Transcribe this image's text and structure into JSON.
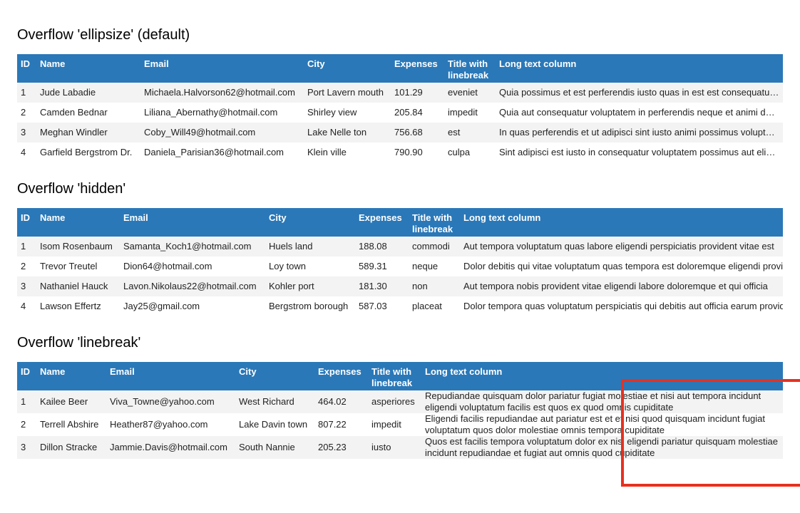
{
  "headers": {
    "id": "ID",
    "name": "Name",
    "email": "Email",
    "city": "City",
    "expenses": "Expenses",
    "title": "Title with linebreak",
    "long": "Long text column"
  },
  "sections": [
    {
      "title": "Overflow 'ellipsize' (default)",
      "rows": [
        {
          "id": "1",
          "name": "Jude Labadie",
          "email": "Michaela.Halvorson62@hotmail.com",
          "city": "Port Lavern mouth",
          "expenses": "101.29",
          "title": "eveniet",
          "long": "Quia possimus et est perferendis iusto quas in est est consequatur voluptatem dolor"
        },
        {
          "id": "2",
          "name": "Camden Bednar",
          "email": "Liliana_Abernathy@hotmail.com",
          "city": "Shirley view",
          "expenses": "205.84",
          "title": "impedit",
          "long": "Quia aut consequatur voluptatem in perferendis neque et animi dolor quisquam"
        },
        {
          "id": "3",
          "name": "Meghan Windler",
          "email": "Coby_Will49@hotmail.com",
          "city": "Lake Nelle ton",
          "expenses": "756.68",
          "title": "est",
          "long": "In quas perferendis et ut adipisci sint iusto animi possimus voluptatem laborum"
        },
        {
          "id": "4",
          "name": "Garfield Bergstrom Dr.",
          "email": "Daniela_Parisian36@hotmail.com",
          "city": "Klein ville",
          "expenses": "790.90",
          "title": "culpa",
          "long": "Sint adipisci est iusto in consequatur voluptatem possimus aut eligendi officia"
        }
      ]
    },
    {
      "title": "Overflow 'hidden'",
      "rows": [
        {
          "id": "1",
          "name": "Isom Rosenbaum",
          "email": "Samanta_Koch1@hotmail.com",
          "city": "Huels land",
          "expenses": "188.08",
          "title": "commodi",
          "long": "Aut tempora voluptatum quas labore eligendi perspiciatis provident vitae est"
        },
        {
          "id": "2",
          "name": "Trevor Treutel",
          "email": "Dion64@hotmail.com",
          "city": "Loy town",
          "expenses": "589.31",
          "title": "neque",
          "long": "Dolor debitis qui vitae voluptatum quas tempora est doloremque eligendi provident"
        },
        {
          "id": "3",
          "name": "Nathaniel Hauck",
          "email": "Lavon.Nikolaus22@hotmail.com",
          "city": "Kohler port",
          "expenses": "181.30",
          "title": "non",
          "long": "Aut tempora nobis provident vitae eligendi labore doloremque et qui officia"
        },
        {
          "id": "4",
          "name": "Lawson Effertz",
          "email": "Jay25@gmail.com",
          "city": "Bergstrom borough",
          "expenses": "587.03",
          "title": "placeat",
          "long": "Dolor tempora quas voluptatum perspiciatis qui debitis aut officia earum provident"
        }
      ]
    },
    {
      "title": "Overflow 'linebreak'",
      "rows": [
        {
          "id": "1",
          "name": "Kailee Beer",
          "email": "Viva_Towne@yahoo.com",
          "city": "West Richard",
          "expenses": "464.02",
          "title": "asperiores",
          "long": "Repudiandae quisquam dolor pariatur fugiat molestiae et nisi aut tempora incidunt eligendi voluptatum facilis est quos ex quod omnis cupiditate"
        },
        {
          "id": "2",
          "name": "Terrell Abshire",
          "email": "Heather87@yahoo.com",
          "city": "Lake Davin town",
          "expenses": "807.22",
          "title": "impedit",
          "long": "Eligendi facilis repudiandae aut pariatur est et et nisi quod quisquam incidunt fugiat voluptatum quos dolor molestiae omnis tempora cupiditate"
        },
        {
          "id": "3",
          "name": "Dillon Stracke",
          "email": "Jammie.Davis@hotmail.com",
          "city": "South Nannie",
          "expenses": "205.23",
          "title": "iusto",
          "long": "Quos est facilis tempora voluptatum dolor ex nisi eligendi pariatur quisquam molestiae incidunt repudiandae et fugiat aut omnis quod cupiditate"
        }
      ]
    }
  ],
  "colors": {
    "header_bg": "#2a78b8",
    "header_text": "#ffffff",
    "row_stripe": "#f3f3f3",
    "highlight_border": "#e8301f"
  }
}
